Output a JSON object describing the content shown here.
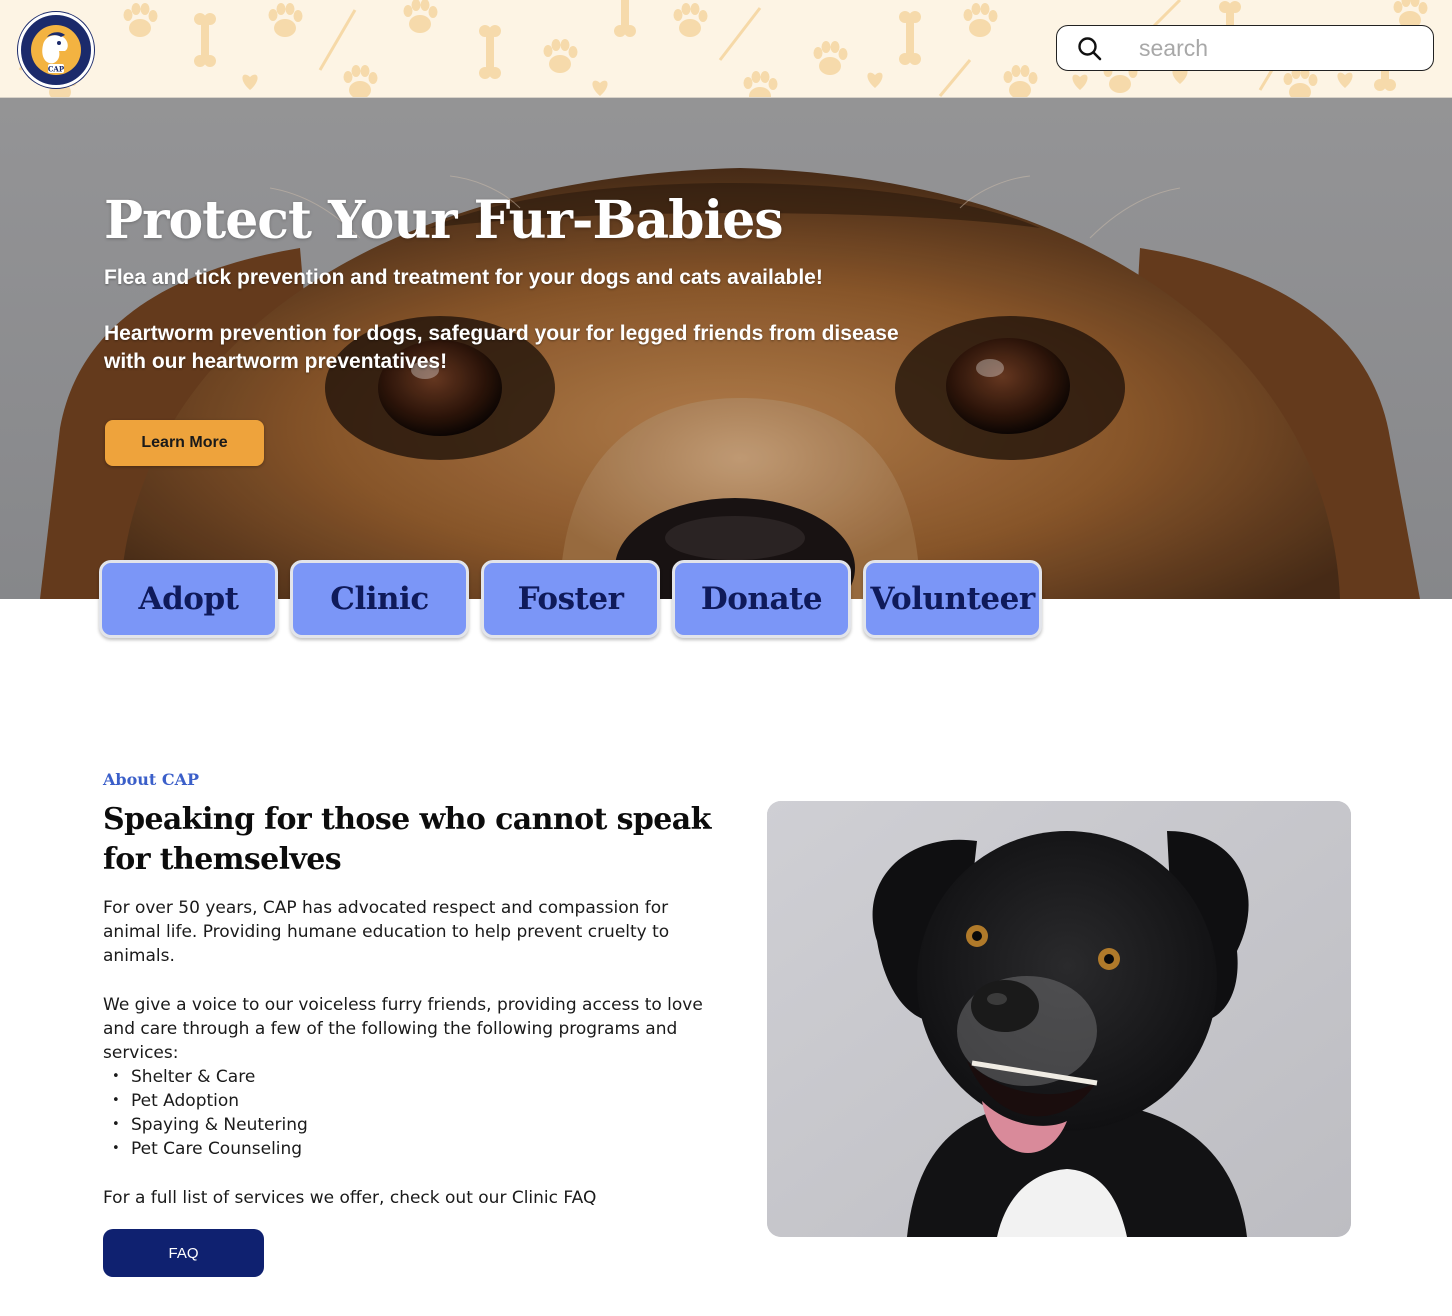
{
  "header": {
    "logo": {
      "name": "cap-logo",
      "ring_text": "CITIZENS FOR ANIMAL PROTECTION",
      "badge_text": "CAP"
    },
    "search": {
      "placeholder": "search",
      "icon": "search-icon"
    },
    "pattern_colors": {
      "background": "#fdf4e4",
      "shapes": "#f6d9a8"
    }
  },
  "hero": {
    "title": "Protect Your Fur-Babies",
    "line1": "Flea and tick prevention and treatment for your dogs and cats available!",
    "line2": "Heartworm prevention for dogs, safeguard your for legged friends from disease with our heartworm preventatives!",
    "cta_label": "Learn More",
    "cta_color": "#eea33c"
  },
  "nav": {
    "tile_color": "#7b96f7",
    "text_color": "#0f1a5a",
    "items": [
      {
        "label": "Adopt"
      },
      {
        "label": "Clinic"
      },
      {
        "label": "Foster"
      },
      {
        "label": "Donate"
      },
      {
        "label": "Volunteer"
      }
    ]
  },
  "about": {
    "eyebrow": "About CAP",
    "title": "Speaking for those who cannot speak for themselves",
    "paragraph1": "For over 50 years, CAP has advocated respect and compassion for animal life. Providing humane education to help prevent cruelty to animals.",
    "paragraph2": "We give a voice to our voiceless furry friends, providing access to love and care through a few of the following the following programs and services:",
    "services": [
      "Shelter & Care",
      "Pet Adoption",
      "Spaying & Neutering",
      "Pet Care Counseling"
    ],
    "paragraph3": "For a full list of services we offer, check out our Clinic FAQ",
    "faq_label": "FAQ",
    "faq_color": "#0f2170"
  }
}
